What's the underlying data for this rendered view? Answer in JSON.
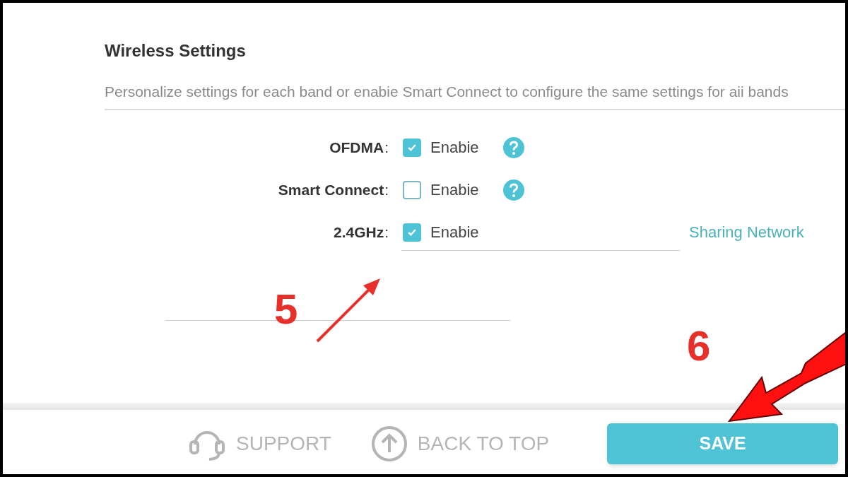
{
  "section": {
    "title": "Wireless Settings",
    "description": "Personalize settings for each band or enabie Smart Connect to configure the same settings for aii bands"
  },
  "settings": [
    {
      "label": "OFDMA",
      "separator": ":",
      "checked": true,
      "option": "Enabie",
      "help": true
    },
    {
      "label": "Smart Connect",
      "separator": ":",
      "checked": false,
      "option": "Enabie",
      "help": true
    },
    {
      "label": "2.4GHz",
      "separator": ":",
      "checked": true,
      "option": "Enabie",
      "help": false,
      "link": "Sharing Network"
    }
  ],
  "footer": {
    "support": "SUPPORT",
    "back_to_top": "BACK TO TOP",
    "save": "SAVE"
  },
  "annotations": [
    {
      "label": "5",
      "kind": "small-arrow"
    },
    {
      "label": "6",
      "kind": "big-arrow"
    }
  ]
}
